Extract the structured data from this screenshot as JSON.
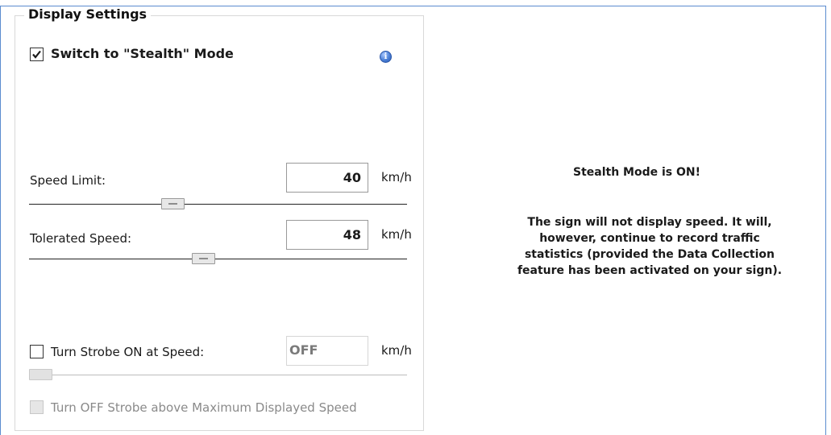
{
  "group": {
    "title": "Display Settings"
  },
  "stealth": {
    "label": "Switch to \"Stealth\" Mode",
    "checked": true,
    "info_icon": "info-icon"
  },
  "speed_limit": {
    "label": "Speed Limit:",
    "value": "40",
    "unit": "km/h"
  },
  "tolerated_speed": {
    "label": "Tolerated Speed:",
    "value": "48",
    "unit": "km/h"
  },
  "strobe": {
    "label": "Turn Strobe ON at Speed:",
    "value": "OFF",
    "unit": "km/h",
    "checked": false
  },
  "strobe_off": {
    "label": "Turn OFF Strobe above Maximum Displayed Speed",
    "checked": false,
    "enabled": false
  },
  "message": {
    "title": "Stealth Mode is ON!",
    "lines": [
      "The sign will not display speed. It will,",
      "however, continue to record traffic",
      "statistics (provided the Data Collection",
      "feature has been activated on your sign)."
    ]
  },
  "colors": {
    "frame": "#5b8ccf",
    "info": "#4a7fd6"
  }
}
